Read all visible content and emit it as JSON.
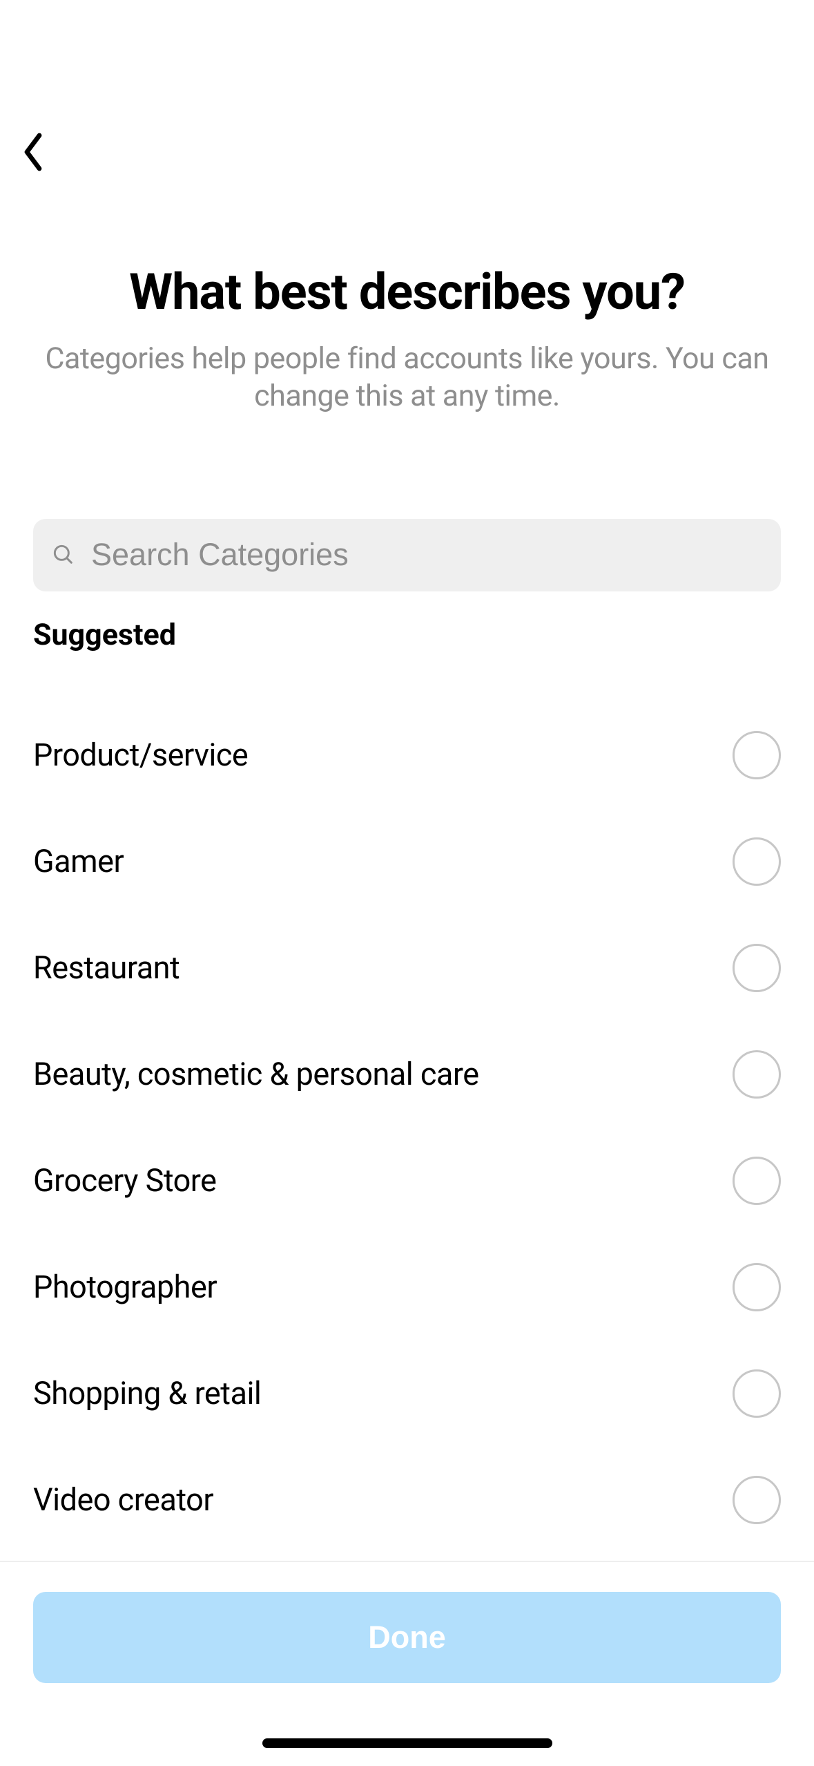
{
  "page": {
    "title": "What best describes you?",
    "subtitle": "Categories help people find accounts like yours. You can change this at any time."
  },
  "search": {
    "placeholder": "Search Categories"
  },
  "section": {
    "header": "Suggested"
  },
  "categories": [
    {
      "label": "Product/service"
    },
    {
      "label": "Gamer"
    },
    {
      "label": "Restaurant"
    },
    {
      "label": "Beauty, cosmetic & personal care"
    },
    {
      "label": "Grocery Store"
    },
    {
      "label": "Photographer"
    },
    {
      "label": "Shopping & retail"
    },
    {
      "label": "Video creator"
    }
  ],
  "footer": {
    "done_label": "Done"
  }
}
